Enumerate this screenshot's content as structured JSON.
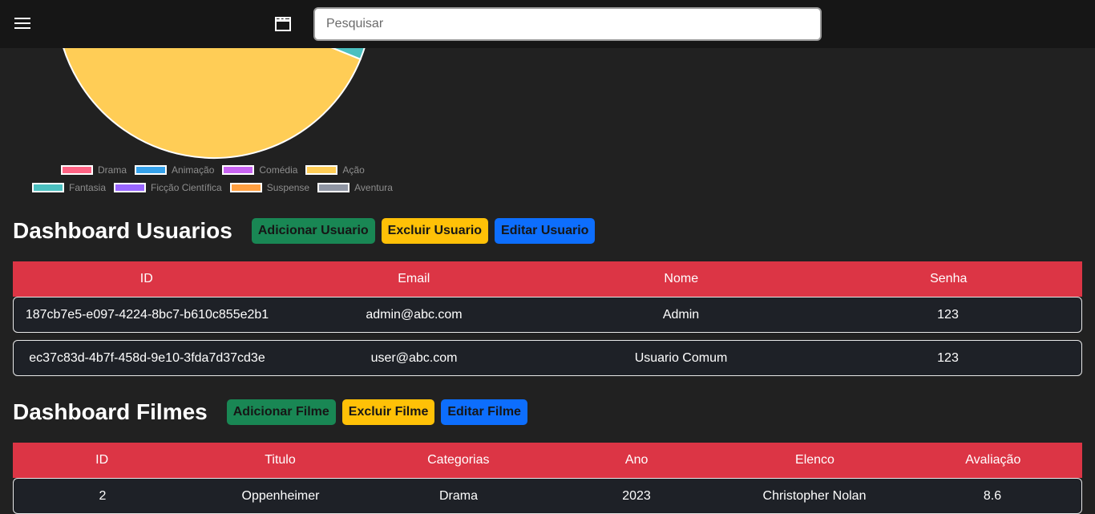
{
  "header": {
    "search_placeholder": "Pesquisar"
  },
  "chart_data": {
    "type": "pie",
    "categories": [
      "Drama",
      "Animação",
      "Comédia",
      "Ação",
      "Fantasia",
      "Ficção Científica",
      "Suspense",
      "Aventura"
    ],
    "values": [
      null,
      null,
      null,
      6,
      1,
      null,
      null,
      null
    ],
    "colors": [
      "#ff6384",
      "#36a2eb",
      "#c964f2",
      "#ffcd56",
      "#4bc0c0",
      "#9966ff",
      "#ff9f40",
      "#8f95a3"
    ],
    "legend_position": "bottom"
  },
  "users_section": {
    "title": "Dashboard Usuarios",
    "add_label": "Adicionar Usuario",
    "delete_label": "Excluir Usuario",
    "edit_label": "Editar Usuario",
    "columns": [
      "ID",
      "Email",
      "Nome",
      "Senha"
    ],
    "rows": [
      [
        "187cb7e5-e097-4224-8bc7-b610c855e2b1",
        "admin@abc.com",
        "Admin",
        "123"
      ],
      [
        "ec37c83d-4b7f-458d-9e10-3fda7d37cd3e",
        "user@abc.com",
        "Usuario Comum",
        "123"
      ]
    ]
  },
  "films_section": {
    "title": "Dashboard Filmes",
    "add_label": "Adicionar Filme",
    "delete_label": "Excluir Filme",
    "edit_label": "Editar Filme",
    "columns": [
      "ID",
      "Titulo",
      "Categorias",
      "Ano",
      "Elenco",
      "Avaliação"
    ],
    "rows": [
      [
        "2",
        "Oppenheimer",
        "Drama",
        "2023",
        "Christopher Nolan",
        "8.6"
      ]
    ]
  }
}
